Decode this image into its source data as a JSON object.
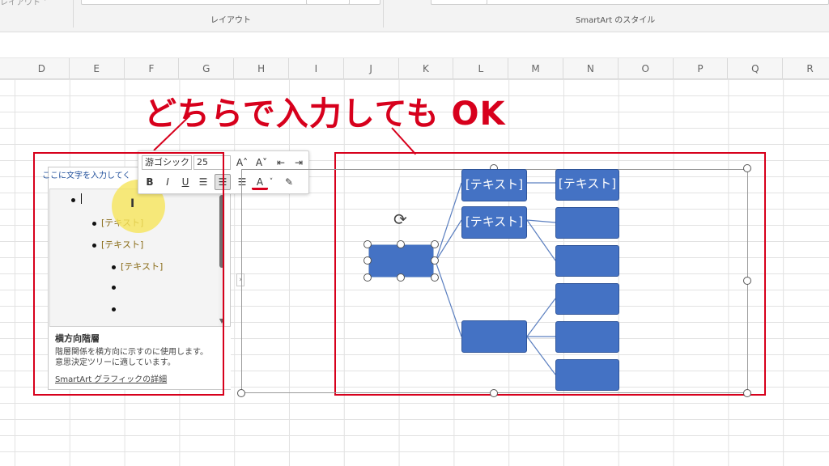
{
  "ribbon": {
    "layout_top": "レイアウト ˅",
    "group_layout": "レイアウト",
    "group_styles": "SmartArt のスタイル"
  },
  "columns": [
    "D",
    "E",
    "F",
    "G",
    "H",
    "I",
    "J",
    "K",
    "L",
    "M",
    "N",
    "O",
    "P",
    "Q",
    "R"
  ],
  "annotation": {
    "heading": "どちらで入力しても OK",
    "color": "#d7001c"
  },
  "text_pane": {
    "title": "ここに文字を入力してく",
    "items": [
      {
        "level": 1,
        "text": ""
      },
      {
        "level": 2,
        "text": "[テキスト]"
      },
      {
        "level": 2,
        "text": "[テキスト]"
      },
      {
        "level": 3,
        "text": "[テキスト]"
      },
      {
        "level": 3,
        "text": ""
      },
      {
        "level": 3,
        "text": ""
      }
    ],
    "desc_title": "横方向階層",
    "desc_line1": "階層関係を横方向に示すのに使用します。",
    "desc_line2": "意思決定ツリーに適しています。",
    "desc_link": "SmartArt グラフィックの詳細",
    "toggle": "›"
  },
  "mini_toolbar": {
    "font_name": "游ゴシック ˅",
    "font_size": "25",
    "grow": "A˄",
    "shrink": "A˅",
    "bold": "B",
    "italic": "I",
    "underline": "U",
    "font_color": "A"
  },
  "smartart": {
    "node_color": "#4472c4",
    "mid_labels": [
      "[テキスト]",
      "[テキスト]",
      ""
    ],
    "right_labels": [
      "[テキスト]",
      "",
      "",
      "",
      "",
      ""
    ]
  }
}
